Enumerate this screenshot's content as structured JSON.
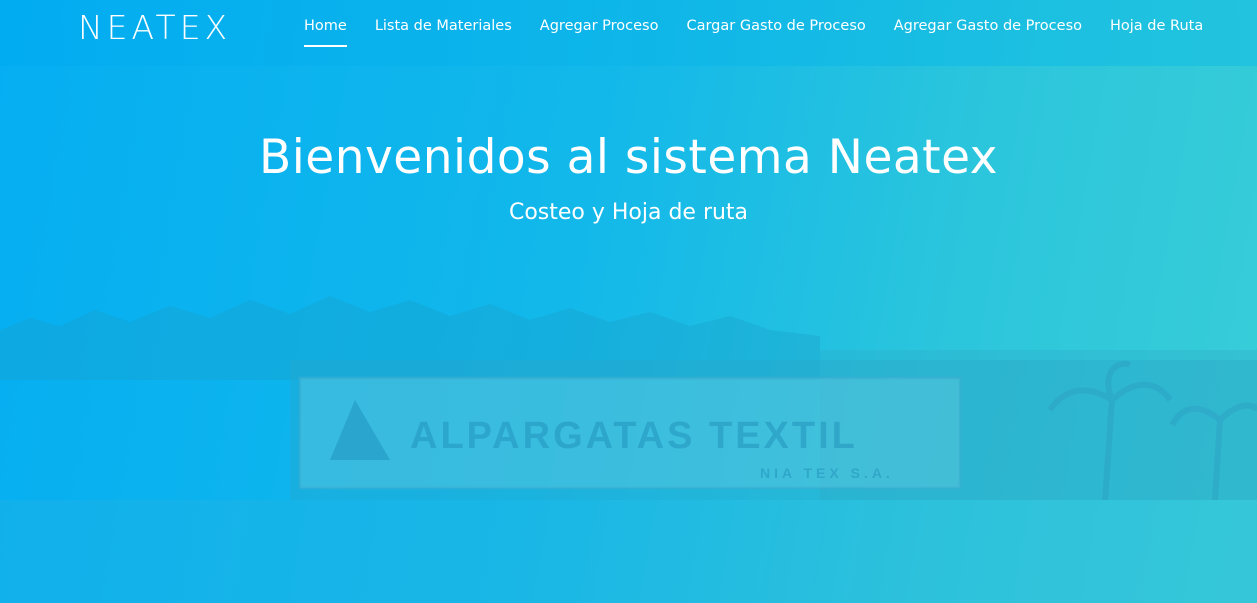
{
  "nav": {
    "brand": "NEATEX",
    "items": [
      {
        "label": "Home",
        "active": true
      },
      {
        "label": "Lista de Materiales",
        "active": false
      },
      {
        "label": "Agregar Proceso",
        "active": false
      },
      {
        "label": "Cargar Gasto de Proceso",
        "active": false
      },
      {
        "label": "Agregar Gasto de Proceso",
        "active": false
      },
      {
        "label": "Hoja de Ruta",
        "active": false
      }
    ]
  },
  "hero": {
    "title": "Bienvenidos al sistema Neatex",
    "subtitle": "Costeo y Hoja de ruta"
  },
  "background": {
    "sign_text": "ALPARGATAS TEXTIL",
    "sign_subtext": "NIA TEX S.A."
  },
  "colors": {
    "gradient_start": "#05aef2",
    "gradient_end": "#38cdd8",
    "text": "#ffffff"
  }
}
